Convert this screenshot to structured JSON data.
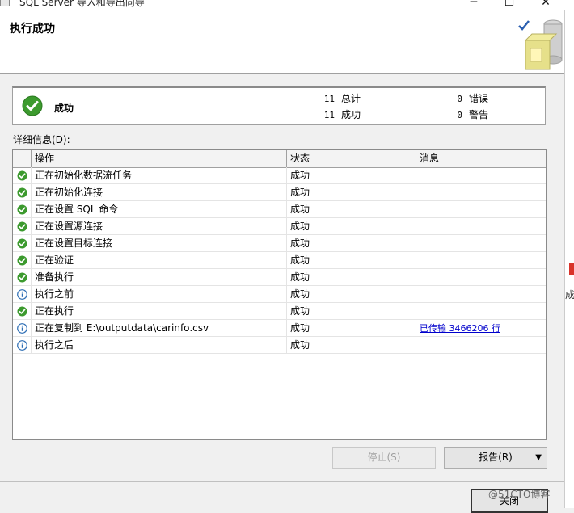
{
  "window": {
    "title": "SQL Server 导入和导出向导",
    "min_label": "─",
    "max_label": "☐",
    "close_label": "✕"
  },
  "header": {
    "heading": "执行成功"
  },
  "summary": {
    "status": "成功",
    "total_count": "11",
    "total_label": "总计",
    "success_count": "11",
    "success_label": "成功",
    "error_count": "0",
    "error_label": "错误",
    "warning_count": "0",
    "warning_label": "警告"
  },
  "details": {
    "label": "详细信息(D):",
    "columns": [
      "操作",
      "状态",
      "消息"
    ],
    "rows": [
      {
        "icon": "success-check-icon",
        "op": "正在初始化数据流任务",
        "status": "成功",
        "message": ""
      },
      {
        "icon": "success-check-icon",
        "op": "正在初始化连接",
        "status": "成功",
        "message": ""
      },
      {
        "icon": "success-check-icon",
        "op": "正在设置 SQL 命令",
        "status": "成功",
        "message": ""
      },
      {
        "icon": "success-check-icon",
        "op": "正在设置源连接",
        "status": "成功",
        "message": ""
      },
      {
        "icon": "success-check-icon",
        "op": "正在设置目标连接",
        "status": "成功",
        "message": ""
      },
      {
        "icon": "success-check-icon",
        "op": "正在验证",
        "status": "成功",
        "message": ""
      },
      {
        "icon": "success-check-icon",
        "op": "准备执行",
        "status": "成功",
        "message": ""
      },
      {
        "icon": "info-icon",
        "op": "执行之前",
        "status": "成功",
        "message": ""
      },
      {
        "icon": "success-check-icon",
        "op": "正在执行",
        "status": "成功",
        "message": ""
      },
      {
        "icon": "info-icon",
        "op": "正在复制到 E:\\outputdata\\carinfo.csv",
        "status": "成功",
        "message": "已传输 3466206 行"
      },
      {
        "icon": "info-icon",
        "op": "执行之后",
        "status": "成功",
        "message": ""
      }
    ]
  },
  "buttons": {
    "stop": "停止(S)",
    "report": "报告(R)",
    "report_arrow": "▼",
    "close": "关闭"
  },
  "side": {
    "cut_text": "成"
  },
  "watermark": "@51CTO博客",
  "colors": {
    "success_green": "#3c9a2e",
    "info_blue": "#2f6fb5",
    "link": "#0000cc"
  }
}
